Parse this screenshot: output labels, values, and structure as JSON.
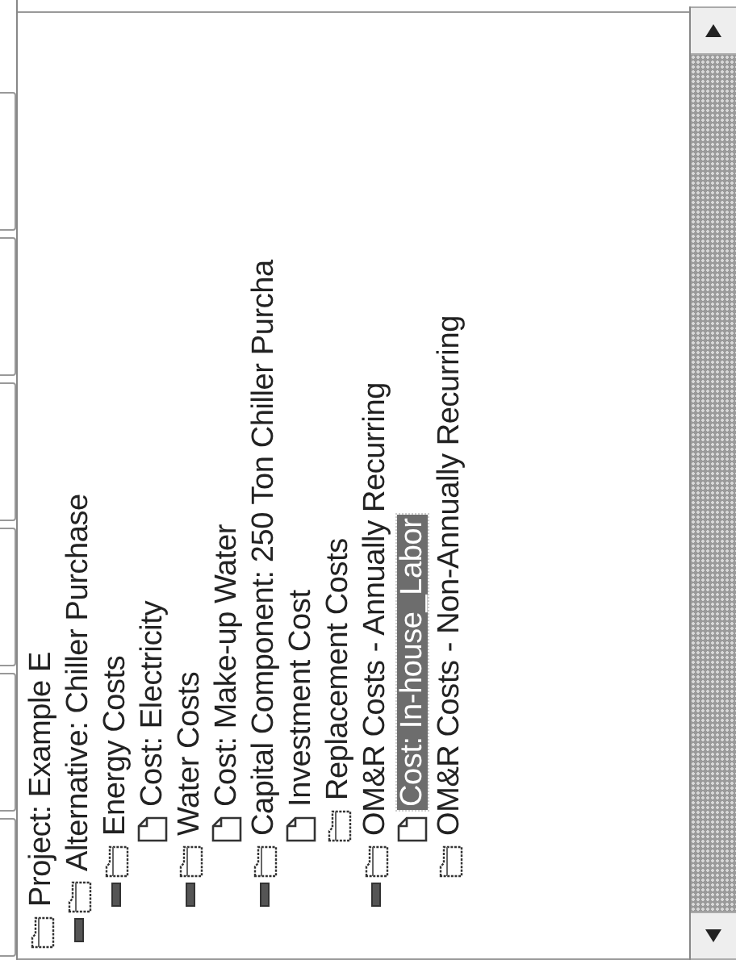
{
  "tree": {
    "label": "Project: Example E",
    "kind": "folder",
    "selected": false,
    "children": [
      {
        "label": "Alternative: Chiller Purchase",
        "kind": "folder",
        "selected": false,
        "expanded": true,
        "children": [
          {
            "label": "Energy Costs",
            "kind": "folder",
            "selected": false,
            "expanded": true,
            "children": [
              {
                "label": "Cost: Electricity",
                "kind": "file",
                "selected": false
              }
            ]
          },
          {
            "label": "Water Costs",
            "kind": "folder",
            "selected": false,
            "expanded": true,
            "children": [
              {
                "label": "Cost: Make-up Water",
                "kind": "file",
                "selected": false
              }
            ]
          },
          {
            "label": "Capital Component: 250 Ton Chiller Purcha",
            "kind": "folder",
            "selected": false,
            "expanded": true,
            "children": [
              {
                "label": "Investment Cost",
                "kind": "file",
                "selected": false
              },
              {
                "label": "Replacement Costs",
                "kind": "folder",
                "selected": false
              }
            ]
          },
          {
            "label": "OM&R Costs - Annually Recurring",
            "kind": "folder",
            "selected": false,
            "expanded": true,
            "children": [
              {
                "label": "Cost: In-house_Labor",
                "kind": "file",
                "selected": true
              }
            ]
          },
          {
            "label": "OM&R Costs - Non-Annually Recurring",
            "kind": "folder",
            "selected": false
          }
        ]
      }
    ]
  }
}
